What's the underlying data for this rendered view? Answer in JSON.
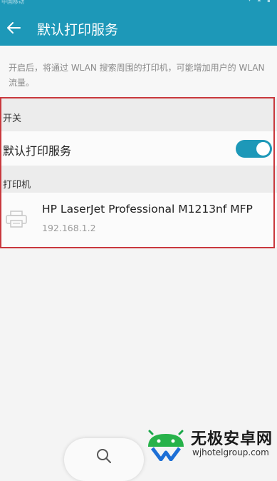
{
  "status_bar": {
    "carrier": "中国移动"
  },
  "header": {
    "title": "默认打印服务",
    "back_icon": "arrow-left-icon"
  },
  "hint": "开启后，将通过 WLAN 搜索周围的打印机，可能增加用户的 WLAN 流量。",
  "sections": {
    "switch": {
      "header": "开关",
      "label": "默认打印服务",
      "toggle_on": true
    },
    "printer": {
      "header": "打印机",
      "item": {
        "name": "HP LaserJet Professional M1213nf MFP",
        "ip": "192.168.1.2",
        "icon": "printer-icon"
      }
    }
  },
  "bottom": {
    "icon": "search-icon"
  },
  "watermark": {
    "name": "无极安卓网",
    "url": "wjhotelgroup.com"
  },
  "colors": {
    "accent": "#1d98b8",
    "highlight": "#c9383d"
  }
}
